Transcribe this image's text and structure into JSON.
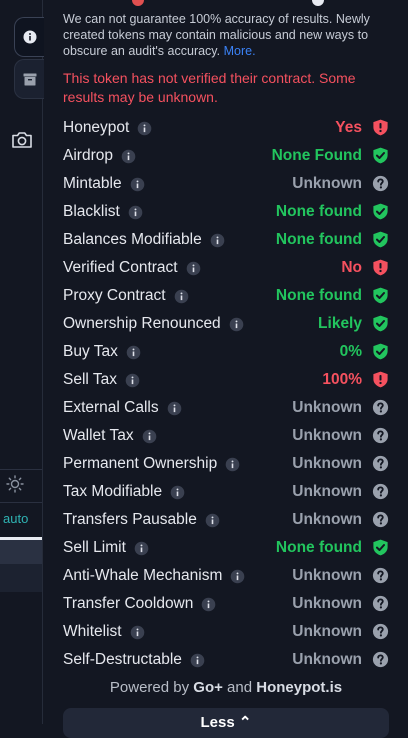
{
  "colors": {
    "background": "#131722",
    "good": "#22c55e",
    "bad": "#f5515f",
    "unknown": "#9aa1ad",
    "link": "#3b82f6",
    "auto": "#2fb3b3"
  },
  "sidebar": {
    "auto_label": "auto",
    "icons": [
      "info-icon",
      "archive-icon",
      "camera-icon",
      "sun-icon"
    ]
  },
  "disclaimer": {
    "text": "We can not guarantee 100% accuracy of results. Newly created tokens may contain malicious and new ways to obscure an audit's accuracy.",
    "more_link": "More."
  },
  "warning": "This token has not verified their contract. Some results may be unknown.",
  "checks": [
    {
      "label": "Honeypot",
      "value": "Yes",
      "status": "bad"
    },
    {
      "label": "Airdrop",
      "value": "None Found",
      "status": "good"
    },
    {
      "label": "Mintable",
      "value": "Unknown",
      "status": "unknown"
    },
    {
      "label": "Blacklist",
      "value": "None found",
      "status": "good"
    },
    {
      "label": "Balances Modifiable",
      "value": "None found",
      "status": "good"
    },
    {
      "label": "Verified Contract",
      "value": "No",
      "status": "bad"
    },
    {
      "label": "Proxy Contract",
      "value": "None found",
      "status": "good"
    },
    {
      "label": "Ownership Renounced",
      "value": "Likely",
      "status": "good"
    },
    {
      "label": "Buy Tax",
      "value": "0%",
      "status": "good"
    },
    {
      "label": "Sell Tax",
      "value": "100%",
      "status": "bad"
    },
    {
      "label": "External Calls",
      "value": "Unknown",
      "status": "unknown"
    },
    {
      "label": "Wallet Tax",
      "value": "Unknown",
      "status": "unknown"
    },
    {
      "label": "Permanent Ownership",
      "value": "Unknown",
      "status": "unknown"
    },
    {
      "label": "Tax Modifiable",
      "value": "Unknown",
      "status": "unknown"
    },
    {
      "label": "Transfers Pausable",
      "value": "Unknown",
      "status": "unknown"
    },
    {
      "label": "Sell Limit",
      "value": "None found",
      "status": "good"
    },
    {
      "label": "Anti-Whale Mechanism",
      "value": "Unknown",
      "status": "unknown"
    },
    {
      "label": "Transfer Cooldown",
      "value": "Unknown",
      "status": "unknown"
    },
    {
      "label": "Whitelist",
      "value": "Unknown",
      "status": "unknown"
    },
    {
      "label": "Self-Destructable",
      "value": "Unknown",
      "status": "unknown"
    }
  ],
  "footer": {
    "powered_prefix": "Powered by",
    "provider_1": "Go+",
    "and": "and",
    "provider_2": "Honeypot.is",
    "less_button": "Less"
  }
}
